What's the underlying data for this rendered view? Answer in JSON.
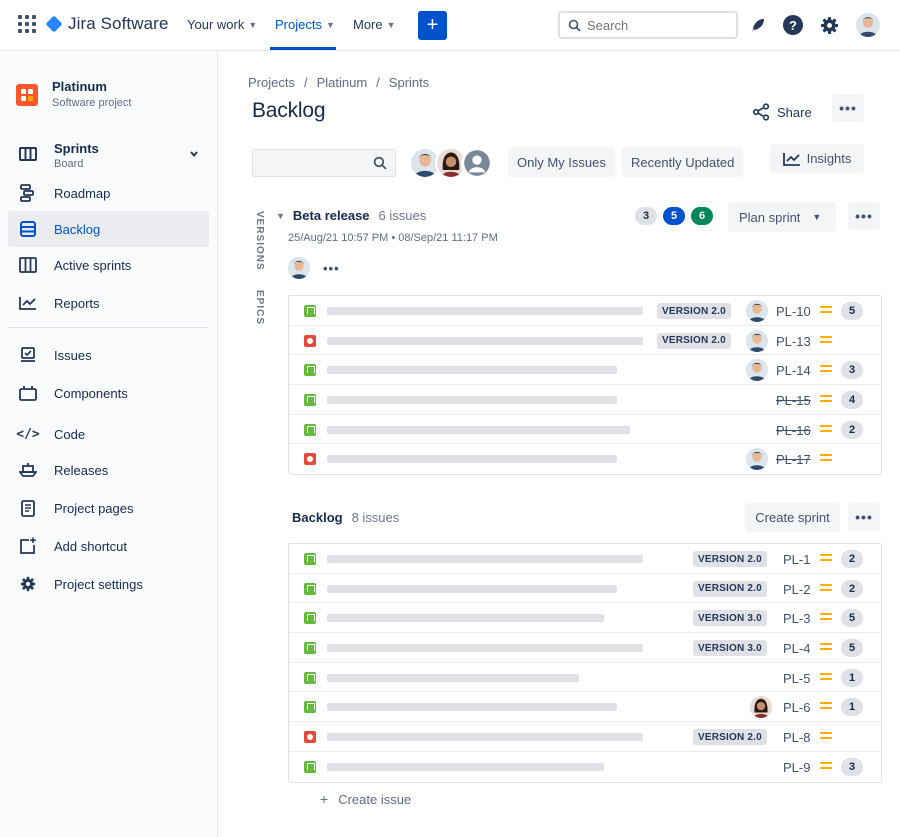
{
  "app": {
    "name": "Jira Software",
    "nav": {
      "your_work": "Your work",
      "projects": "Projects",
      "more": "More"
    },
    "create_label": "+",
    "search_placeholder": "Search"
  },
  "sidebar": {
    "project_name": "Platinum",
    "project_type": "Software project",
    "board_title": "Sprints",
    "board_sub": "Board",
    "items": {
      "roadmap": "Roadmap",
      "backlog": "Backlog",
      "active_sprints": "Active sprints",
      "reports": "Reports",
      "issues": "Issues",
      "components": "Components",
      "code": "Code",
      "releases": "Releases",
      "project_pages": "Project pages",
      "add_shortcut": "Add shortcut",
      "project_settings": "Project settings"
    }
  },
  "page": {
    "breadcrumb": [
      "Projects",
      "Platinum",
      "Sprints"
    ],
    "title": "Backlog",
    "share": "Share",
    "more": "•••",
    "filters": {
      "only_my_issues": "Only My Issues",
      "recently_updated": "Recently Updated"
    },
    "insights": "Insights",
    "side_tabs": {
      "versions": "VERSIONS",
      "epics": "EPICS"
    }
  },
  "sprint": {
    "name": "Beta release",
    "count": "6 issues",
    "dates": "25/Aug/21 10:57 PM • 08/Sep/21 11:17 PM",
    "status_counts": {
      "todo": "3",
      "in_progress": "5",
      "done": "6"
    },
    "plan_sprint": "Plan sprint",
    "issues": [
      {
        "type": "story",
        "version": "VERSION 2.0",
        "assignee": true,
        "key": "PL-10",
        "done": false,
        "estimate": "5"
      },
      {
        "type": "bug",
        "version": "VERSION 2.0",
        "assignee": true,
        "key": "PL-13",
        "done": false,
        "estimate": ""
      },
      {
        "type": "story",
        "version": "",
        "assignee": true,
        "key": "PL-14",
        "done": false,
        "estimate": "3"
      },
      {
        "type": "story",
        "version": "",
        "assignee": false,
        "key": "PL-15",
        "done": true,
        "estimate": "4"
      },
      {
        "type": "story",
        "version": "",
        "assignee": false,
        "key": "PL-16",
        "done": true,
        "estimate": "2"
      },
      {
        "type": "bug",
        "version": "",
        "assignee": true,
        "key": "PL-17",
        "done": true,
        "estimate": ""
      }
    ]
  },
  "backlog": {
    "name": "Backlog",
    "count": "8 issues",
    "create_sprint": "Create sprint",
    "create_issue": "Create issue",
    "issues": [
      {
        "type": "story",
        "version": "VERSION 2.0",
        "assignee": false,
        "key": "PL-1",
        "estimate": "2"
      },
      {
        "type": "story",
        "version": "VERSION 2.0",
        "assignee": false,
        "key": "PL-2",
        "estimate": "2"
      },
      {
        "type": "story",
        "version": "VERSION 3.0",
        "assignee": false,
        "key": "PL-3",
        "estimate": "5"
      },
      {
        "type": "story",
        "version": "VERSION 3.0",
        "assignee": false,
        "key": "PL-4",
        "estimate": "5"
      },
      {
        "type": "story",
        "version": "",
        "assignee": false,
        "key": "PL-5",
        "estimate": "1"
      },
      {
        "type": "story",
        "version": "",
        "assignee": "woman",
        "key": "PL-6",
        "estimate": "1"
      },
      {
        "type": "bug",
        "version": "VERSION 2.0",
        "assignee": false,
        "key": "PL-8",
        "estimate": ""
      },
      {
        "type": "story",
        "version": "",
        "assignee": false,
        "key": "PL-9",
        "estimate": "3"
      }
    ]
  },
  "colors": {
    "brand": "#0052CC",
    "story": "#63BA3C",
    "bug": "#E5493A",
    "priority": "#FFAB00",
    "done_pill": "#00875A"
  }
}
